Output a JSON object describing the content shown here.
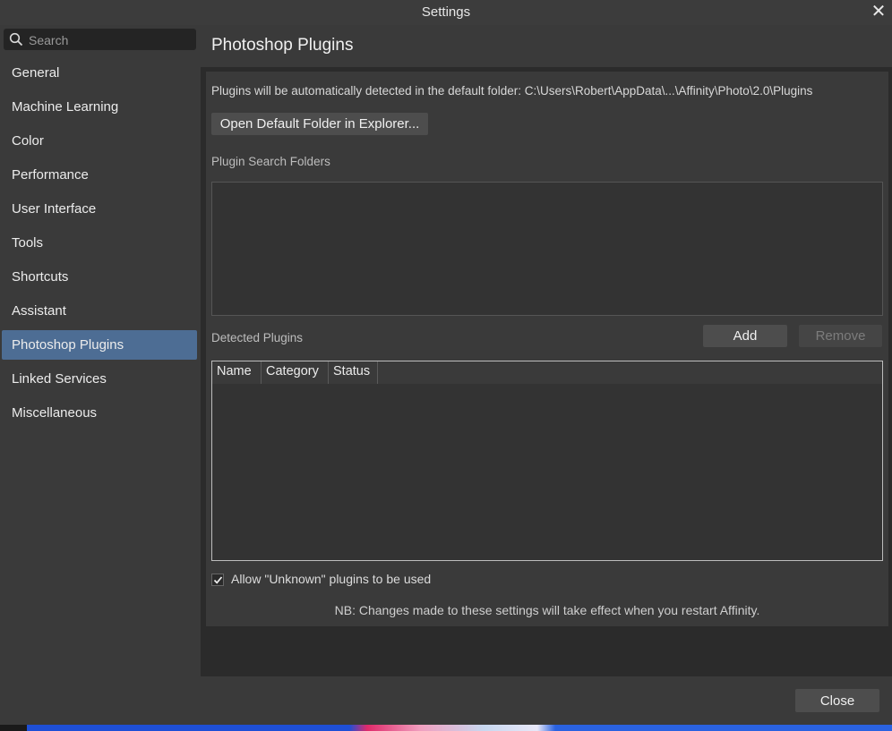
{
  "window": {
    "title": "Settings"
  },
  "search": {
    "placeholder": "Search"
  },
  "sidebar": {
    "items": [
      {
        "label": "General"
      },
      {
        "label": "Machine Learning"
      },
      {
        "label": "Color"
      },
      {
        "label": "Performance"
      },
      {
        "label": "User Interface"
      },
      {
        "label": "Tools"
      },
      {
        "label": "Shortcuts"
      },
      {
        "label": "Assistant"
      },
      {
        "label": "Photoshop Plugins",
        "selected": true
      },
      {
        "label": "Linked Services"
      },
      {
        "label": "Miscellaneous"
      }
    ]
  },
  "main": {
    "title": "Photoshop Plugins",
    "info_text": "Plugins will be automatically detected in the default folder: C:\\Users\\Robert\\AppData\\...\\Affinity\\Photo\\2.0\\Plugins",
    "open_folder_label": "Open Default Folder in Explorer...",
    "search_folders_label": "Plugin Search Folders",
    "detected_label": "Detected Plugins",
    "add_label": "Add",
    "remove_label": "Remove",
    "table_headers": [
      "Name",
      "Category",
      "Status"
    ],
    "allow_unknown_label": "Allow \"Unknown\" plugins to be used",
    "allow_unknown_checked": true,
    "note": "NB: Changes made to these settings will take effect when you restart Affinity."
  },
  "footer": {
    "close_label": "Close"
  },
  "colors": {
    "selected": "#4d6d94",
    "background": "#3a3a3a"
  }
}
